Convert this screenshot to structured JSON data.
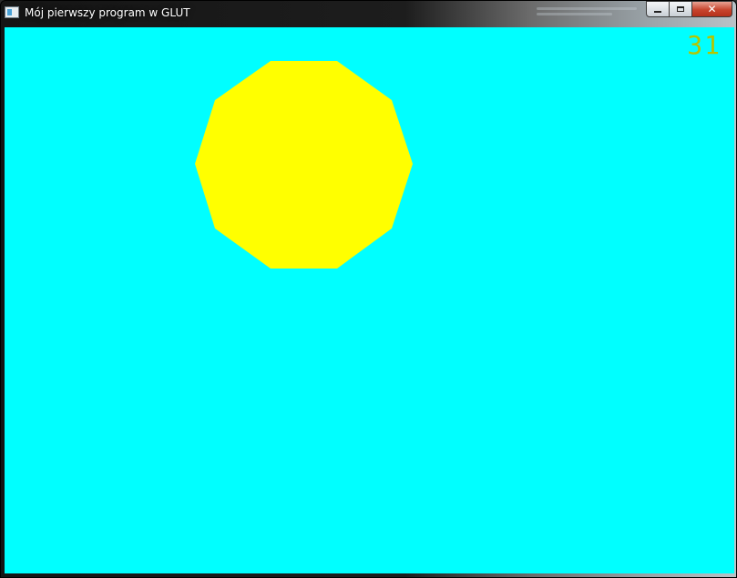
{
  "window": {
    "title": "Mój pierwszy program w GLUT",
    "app_icon": "window-app-icon",
    "buttons": {
      "minimize_icon": "minimize-icon",
      "maximize_icon": "maximize-icon",
      "close_label": "✕"
    }
  },
  "canvas": {
    "background_color": "#00ffff",
    "shape": {
      "kind": "decagon",
      "sides": 10,
      "fill_color": "#ffff00"
    },
    "counter": {
      "value": "31",
      "color": "#b5c500"
    }
  }
}
